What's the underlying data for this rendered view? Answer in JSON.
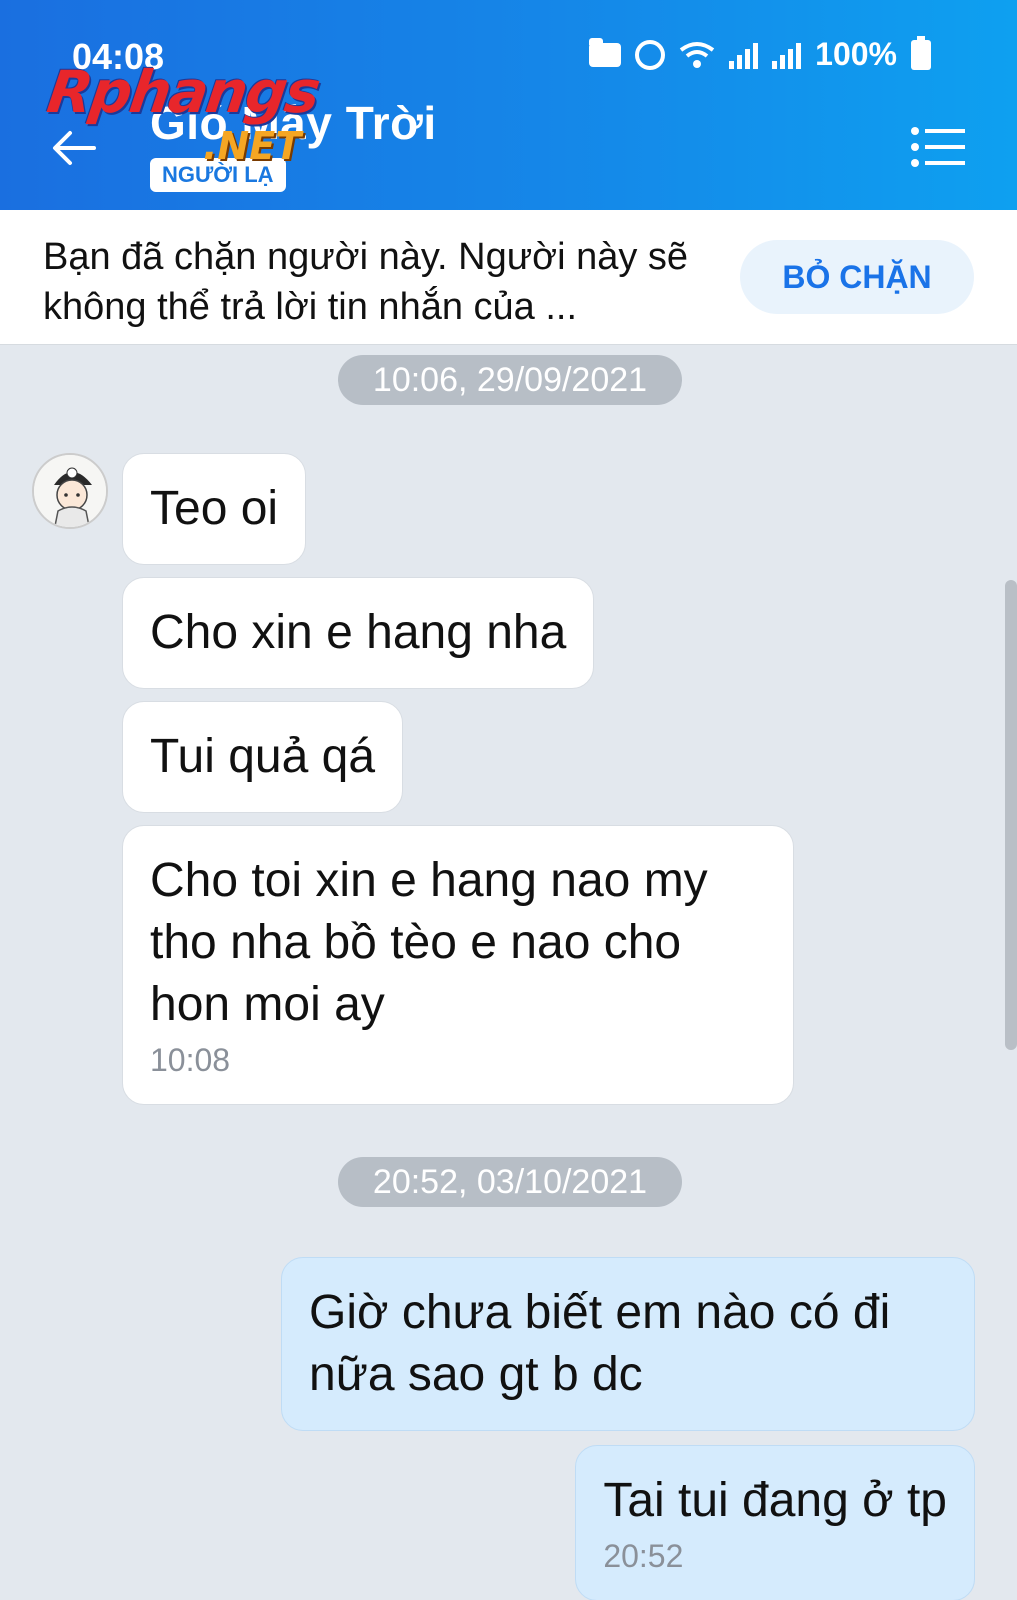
{
  "status_bar": {
    "time": "04:08",
    "battery": "100%",
    "icons": [
      "folder-icon",
      "alarm-icon",
      "wifi-icon",
      "signal-icon",
      "signal-icon",
      "battery-icon"
    ]
  },
  "header": {
    "title": "Gió Mây Trời",
    "badge": "NGƯỜI LẠ",
    "back_icon": "arrow-left-icon",
    "menu_icon": "menu-icon",
    "background": "#1a78e4"
  },
  "watermark": {
    "main": "Rphangs",
    "sub": ".NET"
  },
  "banner": {
    "text": "Bạn đã chặn người này. Người này sẽ không thể trả lời tin nhắn của ...",
    "button": "BỎ CHẶN"
  },
  "chat": {
    "separators": [
      "10:06, 29/09/2021",
      "20:52, 03/10/2021"
    ],
    "messages": [
      {
        "dir": "in",
        "text": "Teo oi"
      },
      {
        "dir": "in",
        "text": "Cho xin e hang nha"
      },
      {
        "dir": "in",
        "text": "Tui quả qá"
      },
      {
        "dir": "in",
        "text": "Cho toi xin e hang nao my tho nha bồ tèo e nao cho hon moi ay",
        "time": "10:08"
      },
      {
        "dir": "out",
        "text": "Giờ chưa biết em nào có đi nữa sao gt b dc"
      },
      {
        "dir": "out",
        "text": "Tai tui đang ở tp",
        "time": "20:52"
      }
    ]
  },
  "colors": {
    "accent": "#1a73e8",
    "outgoing_bubble": "#d5ebfd",
    "chat_background": "#e3e8ee"
  }
}
